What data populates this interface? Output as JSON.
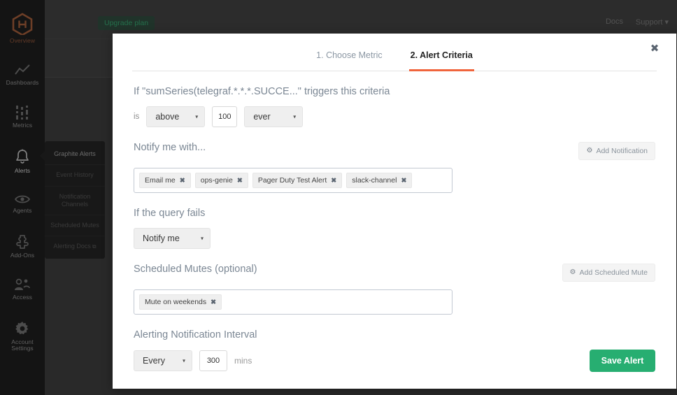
{
  "sidebar": {
    "items": [
      {
        "label": "Overview",
        "icon": "hexagon-gh-logo-icon",
        "state": "brand"
      },
      {
        "label": "Dashboards",
        "icon": "line-chart-icon",
        "state": "normal"
      },
      {
        "label": "Metrics",
        "icon": "metrics-bars-icon",
        "state": "normal"
      },
      {
        "label": "Alerts",
        "icon": "bell-icon",
        "state": "active"
      },
      {
        "label": "Agents",
        "icon": "eye-icon",
        "state": "normal"
      },
      {
        "label": "Add-Ons",
        "icon": "puzzle-piece-icon",
        "state": "normal"
      },
      {
        "label": "Access",
        "icon": "users-icon",
        "state": "normal"
      },
      {
        "label": "Account Settings",
        "icon": "gear-icon",
        "state": "normal"
      }
    ],
    "flyout": {
      "items": [
        {
          "label": "Graphite Alerts",
          "current": true,
          "external": false
        },
        {
          "label": "Event History",
          "current": false,
          "external": false
        },
        {
          "label": "Notification Channels",
          "current": false,
          "external": false
        },
        {
          "label": "Scheduled Mutes",
          "current": false,
          "external": false
        },
        {
          "label": "Alerting Docs",
          "current": false,
          "external": true,
          "external_icon": "⧉"
        }
      ]
    }
  },
  "topbar": {
    "upgrade_label": "Upgrade plan",
    "docs_label": "Docs",
    "support_label": "Support ▾"
  },
  "modal": {
    "close_icon": "✖",
    "tabs": [
      {
        "label": "1. Choose Metric",
        "active": false
      },
      {
        "label": "2. Alert Criteria",
        "active": true
      }
    ],
    "criteria": {
      "title": "If \"sumSeries(telegraf.*.*.*.SUCCE...\" triggers this criteria",
      "is_label": "is",
      "comparator": "above",
      "threshold": "100",
      "occurrence": "ever",
      "caret_icon": "▾"
    },
    "notify": {
      "title": "Notify me with...",
      "add_button_label": "Add Notification",
      "add_button_icon": "⚙",
      "chips": [
        {
          "label": "Email me",
          "remove_icon": "✖"
        },
        {
          "label": "ops-genie",
          "remove_icon": "✖"
        },
        {
          "label": "Pager Duty Test Alert",
          "remove_icon": "✖"
        },
        {
          "label": "slack-channel",
          "remove_icon": "✖"
        }
      ]
    },
    "query_fails": {
      "title": "If the query fails",
      "action": "Notify me",
      "caret_icon": "▾"
    },
    "scheduled_mutes": {
      "title": "Scheduled Mutes (optional)",
      "add_button_label": "Add Scheduled Mute",
      "add_button_icon": "⚙",
      "chips": [
        {
          "label": "Mute on weekends",
          "remove_icon": "✖"
        }
      ]
    },
    "interval": {
      "title": "Alerting Notification Interval",
      "frequency": "Every",
      "caret_icon": "▾",
      "value": "300",
      "unit": "mins"
    },
    "save_label": "Save Alert"
  },
  "colors": {
    "accent_orange": "#f0643c",
    "save_green": "#27ae71",
    "upgrade_green": "#35a06c",
    "sidebar_bg": "#1d1d1d",
    "section_title": "#7b8794"
  }
}
